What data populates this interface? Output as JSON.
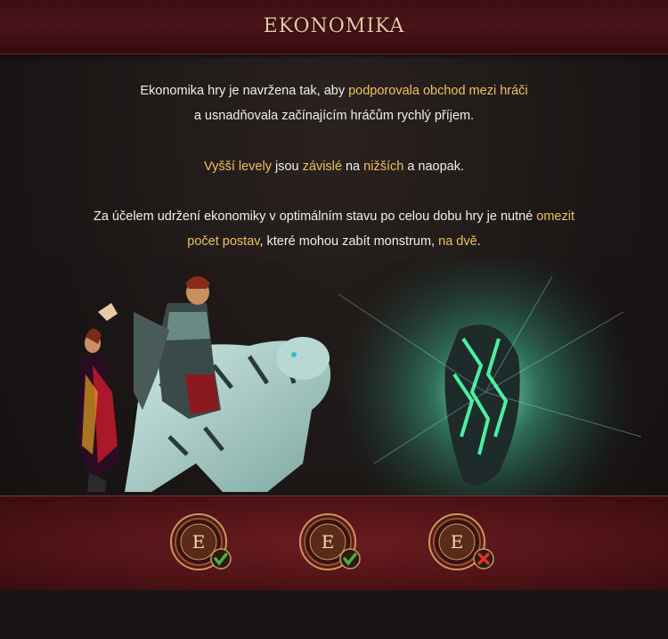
{
  "header": {
    "title": "EKONOMIKA"
  },
  "paragraphs": {
    "p1_l1_a": "Ekonomika hry je navržena tak, aby ",
    "p1_l1_b": "podporovala obchod mezi hráči",
    "p1_l2": "a usnadňovala začínajícím hráčům rychlý příjem.",
    "p2_a": "Vyšší levely",
    "p2_b": " jsou ",
    "p2_c": "závislé",
    "p2_d": " na ",
    "p2_e": "nižších",
    "p2_f": " a naopak.",
    "p3_l1_a": "Za účelem udržení ekonomiky v optimálním stavu po celou dobu hry je nutné ",
    "p3_l1_b": "omezit",
    "p3_l2_a": "počet postav",
    "p3_l2_b": ", které mohou zabít monstrum, ",
    "p3_l2_c": "na dvě",
    "p3_l2_d": "."
  },
  "badges": [
    {
      "letter": "E",
      "status": "allowed",
      "icon": "check-icon"
    },
    {
      "letter": "E",
      "status": "allowed",
      "icon": "check-icon"
    },
    {
      "letter": "E",
      "status": "denied",
      "icon": "cross-icon"
    }
  ],
  "colors": {
    "accent": "#f0c15a",
    "check": "#4caf3c",
    "cross": "#d9322e",
    "footer": "#5a161b"
  }
}
